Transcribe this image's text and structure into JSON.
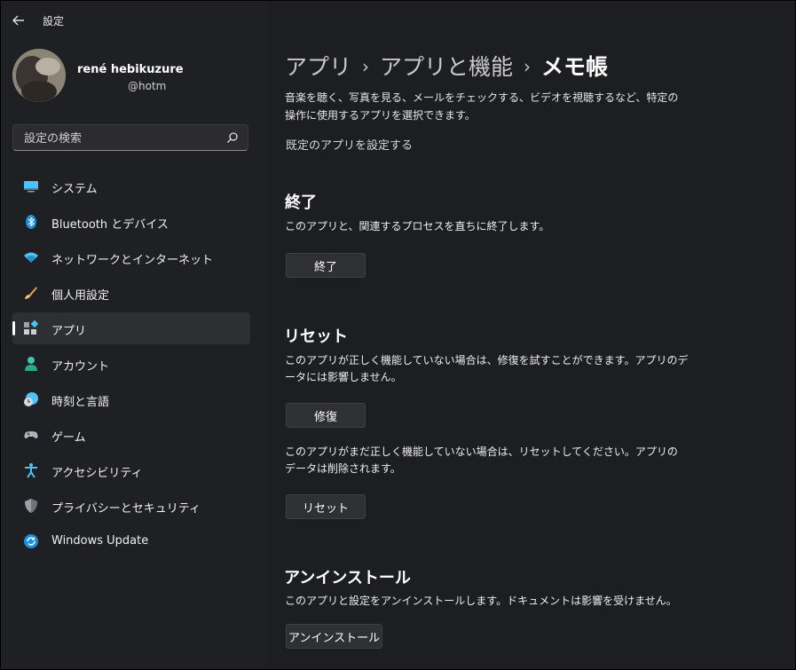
{
  "window": {
    "title": "設定"
  },
  "user": {
    "name": "rené hebikuzure",
    "email": "@hotma"
  },
  "search": {
    "placeholder": "設定の検索"
  },
  "nav": {
    "items": [
      {
        "label": "システム",
        "icon": "system-icon"
      },
      {
        "label": "Bluetooth とデバイス",
        "icon": "bluetooth-icon"
      },
      {
        "label": "ネットワークとインターネット",
        "icon": "network-icon"
      },
      {
        "label": "個人用設定",
        "icon": "paintbrush-icon"
      },
      {
        "label": "アプリ",
        "icon": "apps-icon",
        "selected": true
      },
      {
        "label": "アカウント",
        "icon": "account-icon"
      },
      {
        "label": "時刻と言語",
        "icon": "time-language-icon"
      },
      {
        "label": "ゲーム",
        "icon": "gamepad-icon"
      },
      {
        "label": "アクセシビリティ",
        "icon": "accessibility-icon"
      },
      {
        "label": "プライバシーとセキュリティ",
        "icon": "shield-icon"
      },
      {
        "label": "Windows Update",
        "icon": "windows-update-icon"
      }
    ]
  },
  "breadcrumb": {
    "level1": "アプリ",
    "level2": "アプリと機能",
    "current": "メモ帳",
    "separator": "›"
  },
  "intro": {
    "text": "音楽を聴く、写真を見る、メールをチェックする、ビデオを視聴するなど、特定の操作に使用するアプリを選択できます。",
    "default_apps_link": "既定のアプリを設定する"
  },
  "terminate": {
    "title": "終了",
    "text": "このアプリと、関連するプロセスを直ちに終了します。",
    "button": "終了"
  },
  "reset": {
    "title": "リセット",
    "repair_text": "このアプリが正しく機能していない場合は、修復を試すことができます。アプリのデータには影響しません。",
    "repair_button": "修復",
    "reset_text": "このアプリがまだ正しく機能していない場合は、リセットしてください。アプリのデータは削除されます。",
    "reset_button": "リセット"
  },
  "uninstall": {
    "title": "アンインストール",
    "text": "このアプリと設定をアンインストールします。ドキュメントは影響を受けません。",
    "button": "アンインストール"
  },
  "colors": {
    "background": "#202020",
    "selected_nav": "#2d2f33",
    "accent": "#4cc2ff"
  }
}
